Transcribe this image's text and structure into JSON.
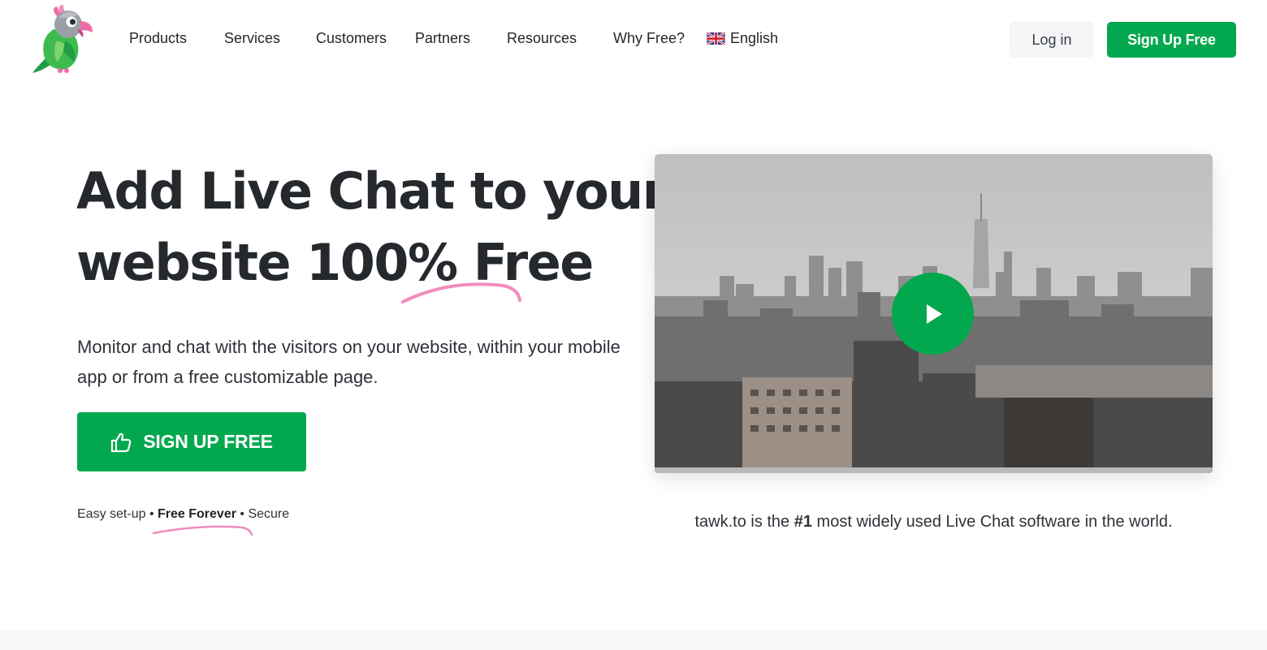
{
  "header": {
    "nav": [
      {
        "label": "Products"
      },
      {
        "label": "Services"
      },
      {
        "label": "Customers"
      },
      {
        "label": "Partners"
      },
      {
        "label": "Resources"
      },
      {
        "label": "Why Free?"
      }
    ],
    "language": "English",
    "login_label": "Log in",
    "signup_label": "Sign Up Free"
  },
  "hero": {
    "title_line1": "Add Live Chat to your",
    "title_line2_a": "website 100% ",
    "title_line2_b": "Free",
    "subtitle": "Monitor and chat with the visitors on your website, within your mobile app or from a free customizable page.",
    "cta_label": "SIGN UP FREE",
    "features": {
      "a": "Easy set-up",
      "sep": "•",
      "b": "Free Forever",
      "c": "Secure"
    }
  },
  "video": {
    "tagline_a": "tawk.to is the ",
    "tagline_b": "#1",
    "tagline_c": " most widely used Live Chat software in the world."
  },
  "colors": {
    "brand_green": "#03a84e",
    "accent_pink": "#f08cbc",
    "text_dark": "#25292e"
  }
}
